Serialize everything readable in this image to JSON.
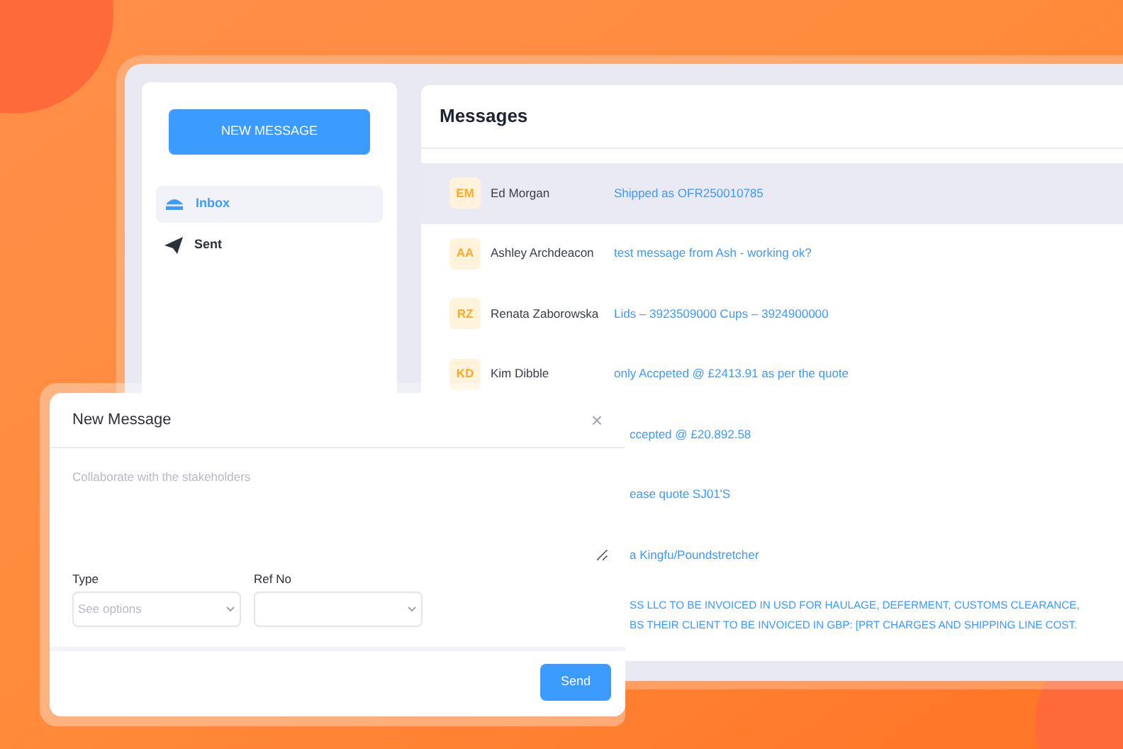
{
  "sidebar": {
    "new_button": "NEW MESSAGE",
    "items": [
      {
        "label": "Inbox",
        "kind": "inbox",
        "selected": true
      },
      {
        "label": "Sent",
        "kind": "sent",
        "selected": false
      }
    ]
  },
  "messages": {
    "title": "Messages",
    "rows": [
      {
        "initials": "EM",
        "name": "Ed Morgan",
        "lines": [
          "Shipped as OFR250010785"
        ],
        "selected": true
      },
      {
        "initials": "AA",
        "name": "Ashley Archdeacon",
        "lines": [
          "test message from Ash - working ok?"
        ],
        "selected": false
      },
      {
        "initials": "RZ",
        "name": "Renata Zaborowska",
        "lines": [
          "Lids – 3923509000 Cups – 3924900000"
        ],
        "selected": false
      },
      {
        "initials": "KD",
        "name": "Kim Dibble",
        "lines": [
          "only Accpeted @ £2413.91 as per the quote"
        ],
        "selected": false
      },
      {
        "lines": [
          "ccepted @ £20.892.58"
        ],
        "selected": false
      },
      {
        "lines": [
          "ease quote SJ01'S"
        ],
        "selected": false
      },
      {
        "lines": [
          "a Kingfu/Poundstretcher"
        ],
        "selected": false
      },
      {
        "lines": [
          "SS LLC TO BE INVOICED IN USD FOR HAULAGE, DEFERMENT, CUSTOMS CLEARANCE,",
          "BS THEIR CLIENT TO BE INVOICED IN GBP: [PRT CHARGES AND SHIPPING LINE COST."
        ],
        "selected": false
      }
    ]
  },
  "modal": {
    "title": "New Message",
    "close": "×",
    "message_placeholder": "Collaborate with the stakeholders",
    "fields": [
      {
        "label": "Type",
        "placeholder": "See options"
      },
      {
        "label": "Ref No"
      }
    ],
    "send": "Send"
  }
}
